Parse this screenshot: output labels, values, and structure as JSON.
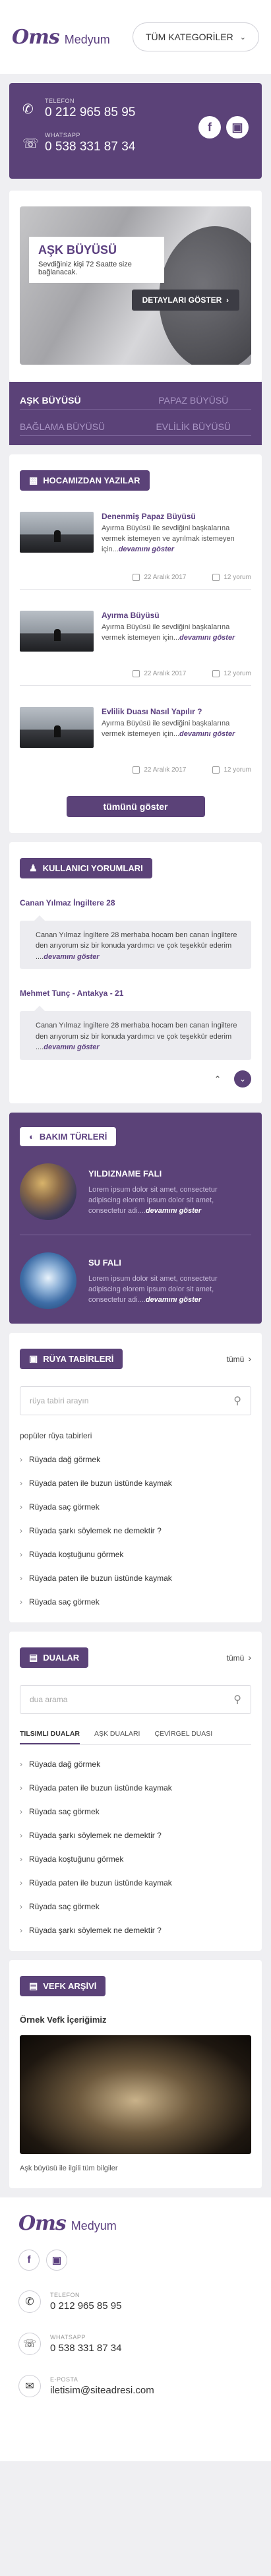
{
  "header": {
    "logo_mark": "Oms",
    "logo_name": "Medyum",
    "category_button": "TÜM KATEGORİLER"
  },
  "contact": {
    "phone_label": "TELEFON",
    "phone": "0 212 965 85 95",
    "whatsapp_label": "WHATSAPP",
    "whatsapp": "0 538 331 87 34"
  },
  "slider": {
    "title": "AŞK BÜYÜSÜ",
    "subtitle": "Sevdiğiniz kişi 72 Saatte size bağlanacak.",
    "button": "DETAYLARI GÖSTER"
  },
  "tabs": [
    "AŞK BÜYÜSÜ",
    "PAPAZ BÜYÜSÜ",
    "BAĞLAMA BÜYÜSÜ",
    "EVLİLİK BÜYÜSÜ"
  ],
  "articles_section": {
    "title": "HOCAMIZDAN YAZILAR",
    "items": [
      {
        "title": "Denenmiş Papaz Büyüsü",
        "text": "Ayırma Büyüsü ile sevdiğini başkalarına vermek istemeyen ve ayrılmak istemeyen için...",
        "read_more": "devamını göster",
        "date": "22 Aralık 2017",
        "views": "12 yorum"
      },
      {
        "title": "Ayırma Büyüsü",
        "text": "Ayırma Büyüsü ile sevdiğini başkalarına vermek istemeyen için...",
        "read_more": "devamını göster",
        "date": "22 Aralık 2017",
        "views": "12 yorum"
      },
      {
        "title": "Evlilik Duası Nasıl Yapılır ?",
        "text": "Ayırma Büyüsü ile sevdiğini başkalarına vermek istemeyen için...",
        "read_more": "devamını göster",
        "date": "22 Aralık 2017",
        "views": "12 yorum"
      }
    ],
    "all_button": "tümünü göster"
  },
  "comments_section": {
    "title": "KULLANICI YORUMLARI",
    "items": [
      {
        "name": "Canan Yılmaz İngiltere 28",
        "text": "Canan Yılmaz İngiltere 28 merhaba hocam ben canan İngiltere den arıyorum siz bir konuda yardımcı ve çok teşekkür ederim ....",
        "read_more": "devamını göster"
      },
      {
        "name": "Mehmet Tunç - Antakya - 21",
        "text": "Canan Yılmaz İngiltere 28 merhaba hocam ben canan İngiltere den arıyorum siz bir konuda yardımcı ve çok teşekkür ederim ....",
        "read_more": "devamını göster"
      }
    ]
  },
  "bakim_section": {
    "title": "BAKIM TÜRLERİ",
    "items": [
      {
        "title": "YILDIZNAME FALI",
        "text": "Lorem ipsum dolor sit amet, consectetur adipiscing elorem ipsum dolor sit amet, consectetur adi....",
        "read_more": "devamını göster"
      },
      {
        "title": "SU FALI",
        "text": "Lorem ipsum dolor sit amet, consectetur adipiscing elorem ipsum dolor sit amet, consectetur adi....",
        "read_more": "devamını göster"
      }
    ]
  },
  "ruya_section": {
    "title": "RÜYA TABİRLERİ",
    "more": "tümü",
    "search_placeholder": "rüya tabiri arayın",
    "sub_label": "popüler rüya tabirleri",
    "items": [
      "Rüyada dağ görmek",
      "Rüyada paten ile buzun üstünde kaymak",
      "Rüyada saç görmek",
      "Rüyada şarkı söylemek ne demektir ?",
      "Rüyada koştuğunu görmek",
      "Rüyada paten ile buzun üstünde kaymak",
      "Rüyada saç görmek"
    ]
  },
  "dualar_section": {
    "title": "DUALAR",
    "more": "tümü",
    "search_placeholder": "dua arama",
    "tabs": [
      "TILSIMLI DUALAR",
      "AŞK DUALARI",
      "ÇEVİRGEL DUASI"
    ],
    "items": [
      "Rüyada dağ görmek",
      "Rüyada paten ile buzun üstünde kaymak",
      "Rüyada saç görmek",
      "Rüyada şarkı söylemek ne demektir ?",
      "Rüyada koştuğunu görmek",
      "Rüyada paten ile buzun üstünde kaymak",
      "Rüyada saç görmek",
      "Rüyada şarkı söylemek ne demektir ?"
    ]
  },
  "vefk_section": {
    "title": "VEFK ARŞİVİ",
    "item_title": "Örnek Vefk İçeriğimiz",
    "caption": "Aşk büyüsü ile ilgili tüm bilgiler"
  },
  "footer": {
    "logo_mark": "Oms",
    "logo_name": "Medyum",
    "phone_label": "TELEFON",
    "phone": "0 212 965 85 95",
    "whatsapp_label": "WHATSAPP",
    "whatsapp": "0 538 331 87 34",
    "email_label": "E-POSTA",
    "email": "iletisim@siteadresi.com"
  },
  "colors": {
    "primary": "#5b4278",
    "background": "#efeff2"
  }
}
